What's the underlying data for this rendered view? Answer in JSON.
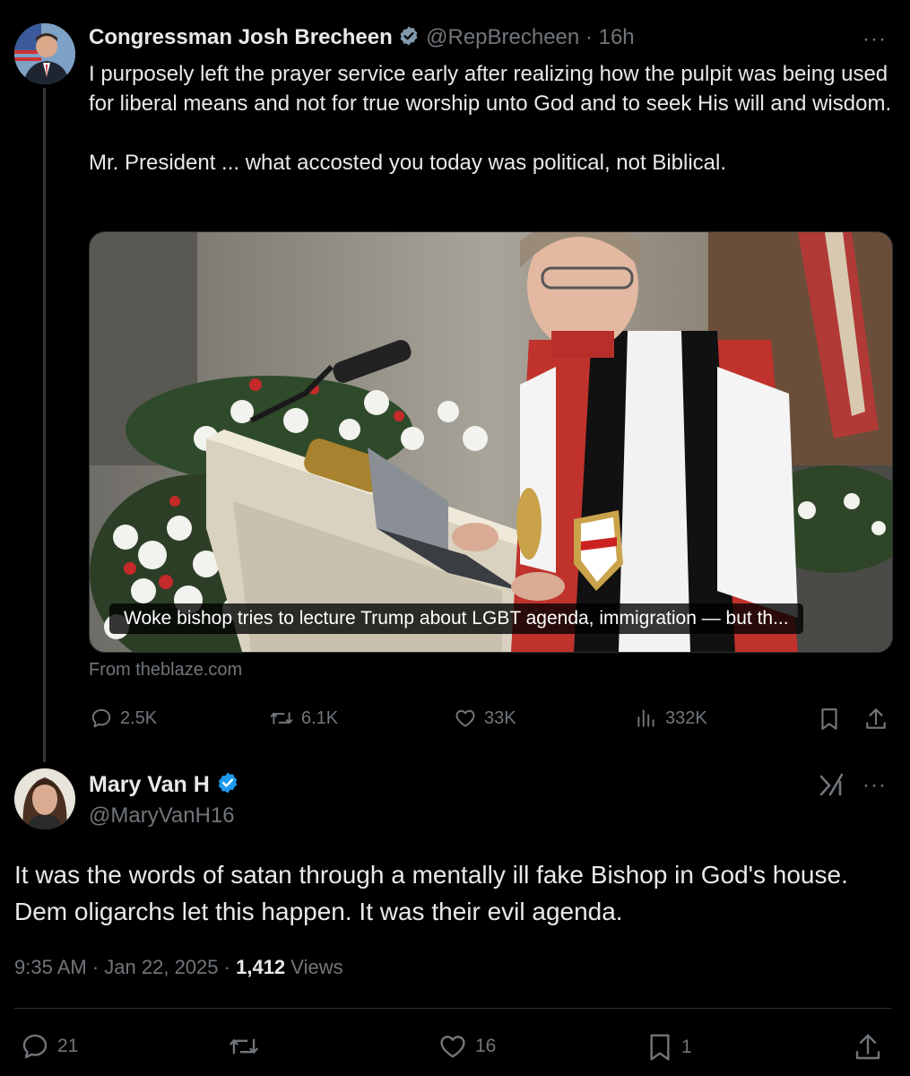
{
  "tweet1": {
    "author_name": "Congressman Josh Brecheen",
    "handle": "@RepBrecheen",
    "time": "16h",
    "paragraphs": [
      "I purposely left the prayer service early after realizing how the pulpit was being used for liberal means and not for true worship unto God and to seek His will and wisdom.",
      "Mr. President ... what accosted you today was political, not Biblical."
    ],
    "media_caption": "Woke bishop tries to lecture Trump about LGBT agenda, immigration — but th...",
    "source": "From theblaze.com",
    "stats": {
      "replies": "2.5K",
      "reposts": "6.1K",
      "likes": "33K",
      "views": "332K"
    },
    "badge_color": "#829aab"
  },
  "tweet2": {
    "author_name": "Mary Van H",
    "handle": "@MaryVanH16",
    "text": "It was the words of satan through a mentally ill fake Bishop in God's house.  Dem oligarchs let this happen.  It was their evil agenda.",
    "time": "9:35 AM",
    "date": "Jan 22, 2025",
    "views_count": "1,412",
    "views_label": "Views",
    "stats": {
      "replies": "21",
      "likes": "16",
      "bookmarks": "1"
    },
    "badge_color": "#1d9bf0"
  },
  "ui": {
    "separator": "·",
    "more_glyph": "···"
  }
}
